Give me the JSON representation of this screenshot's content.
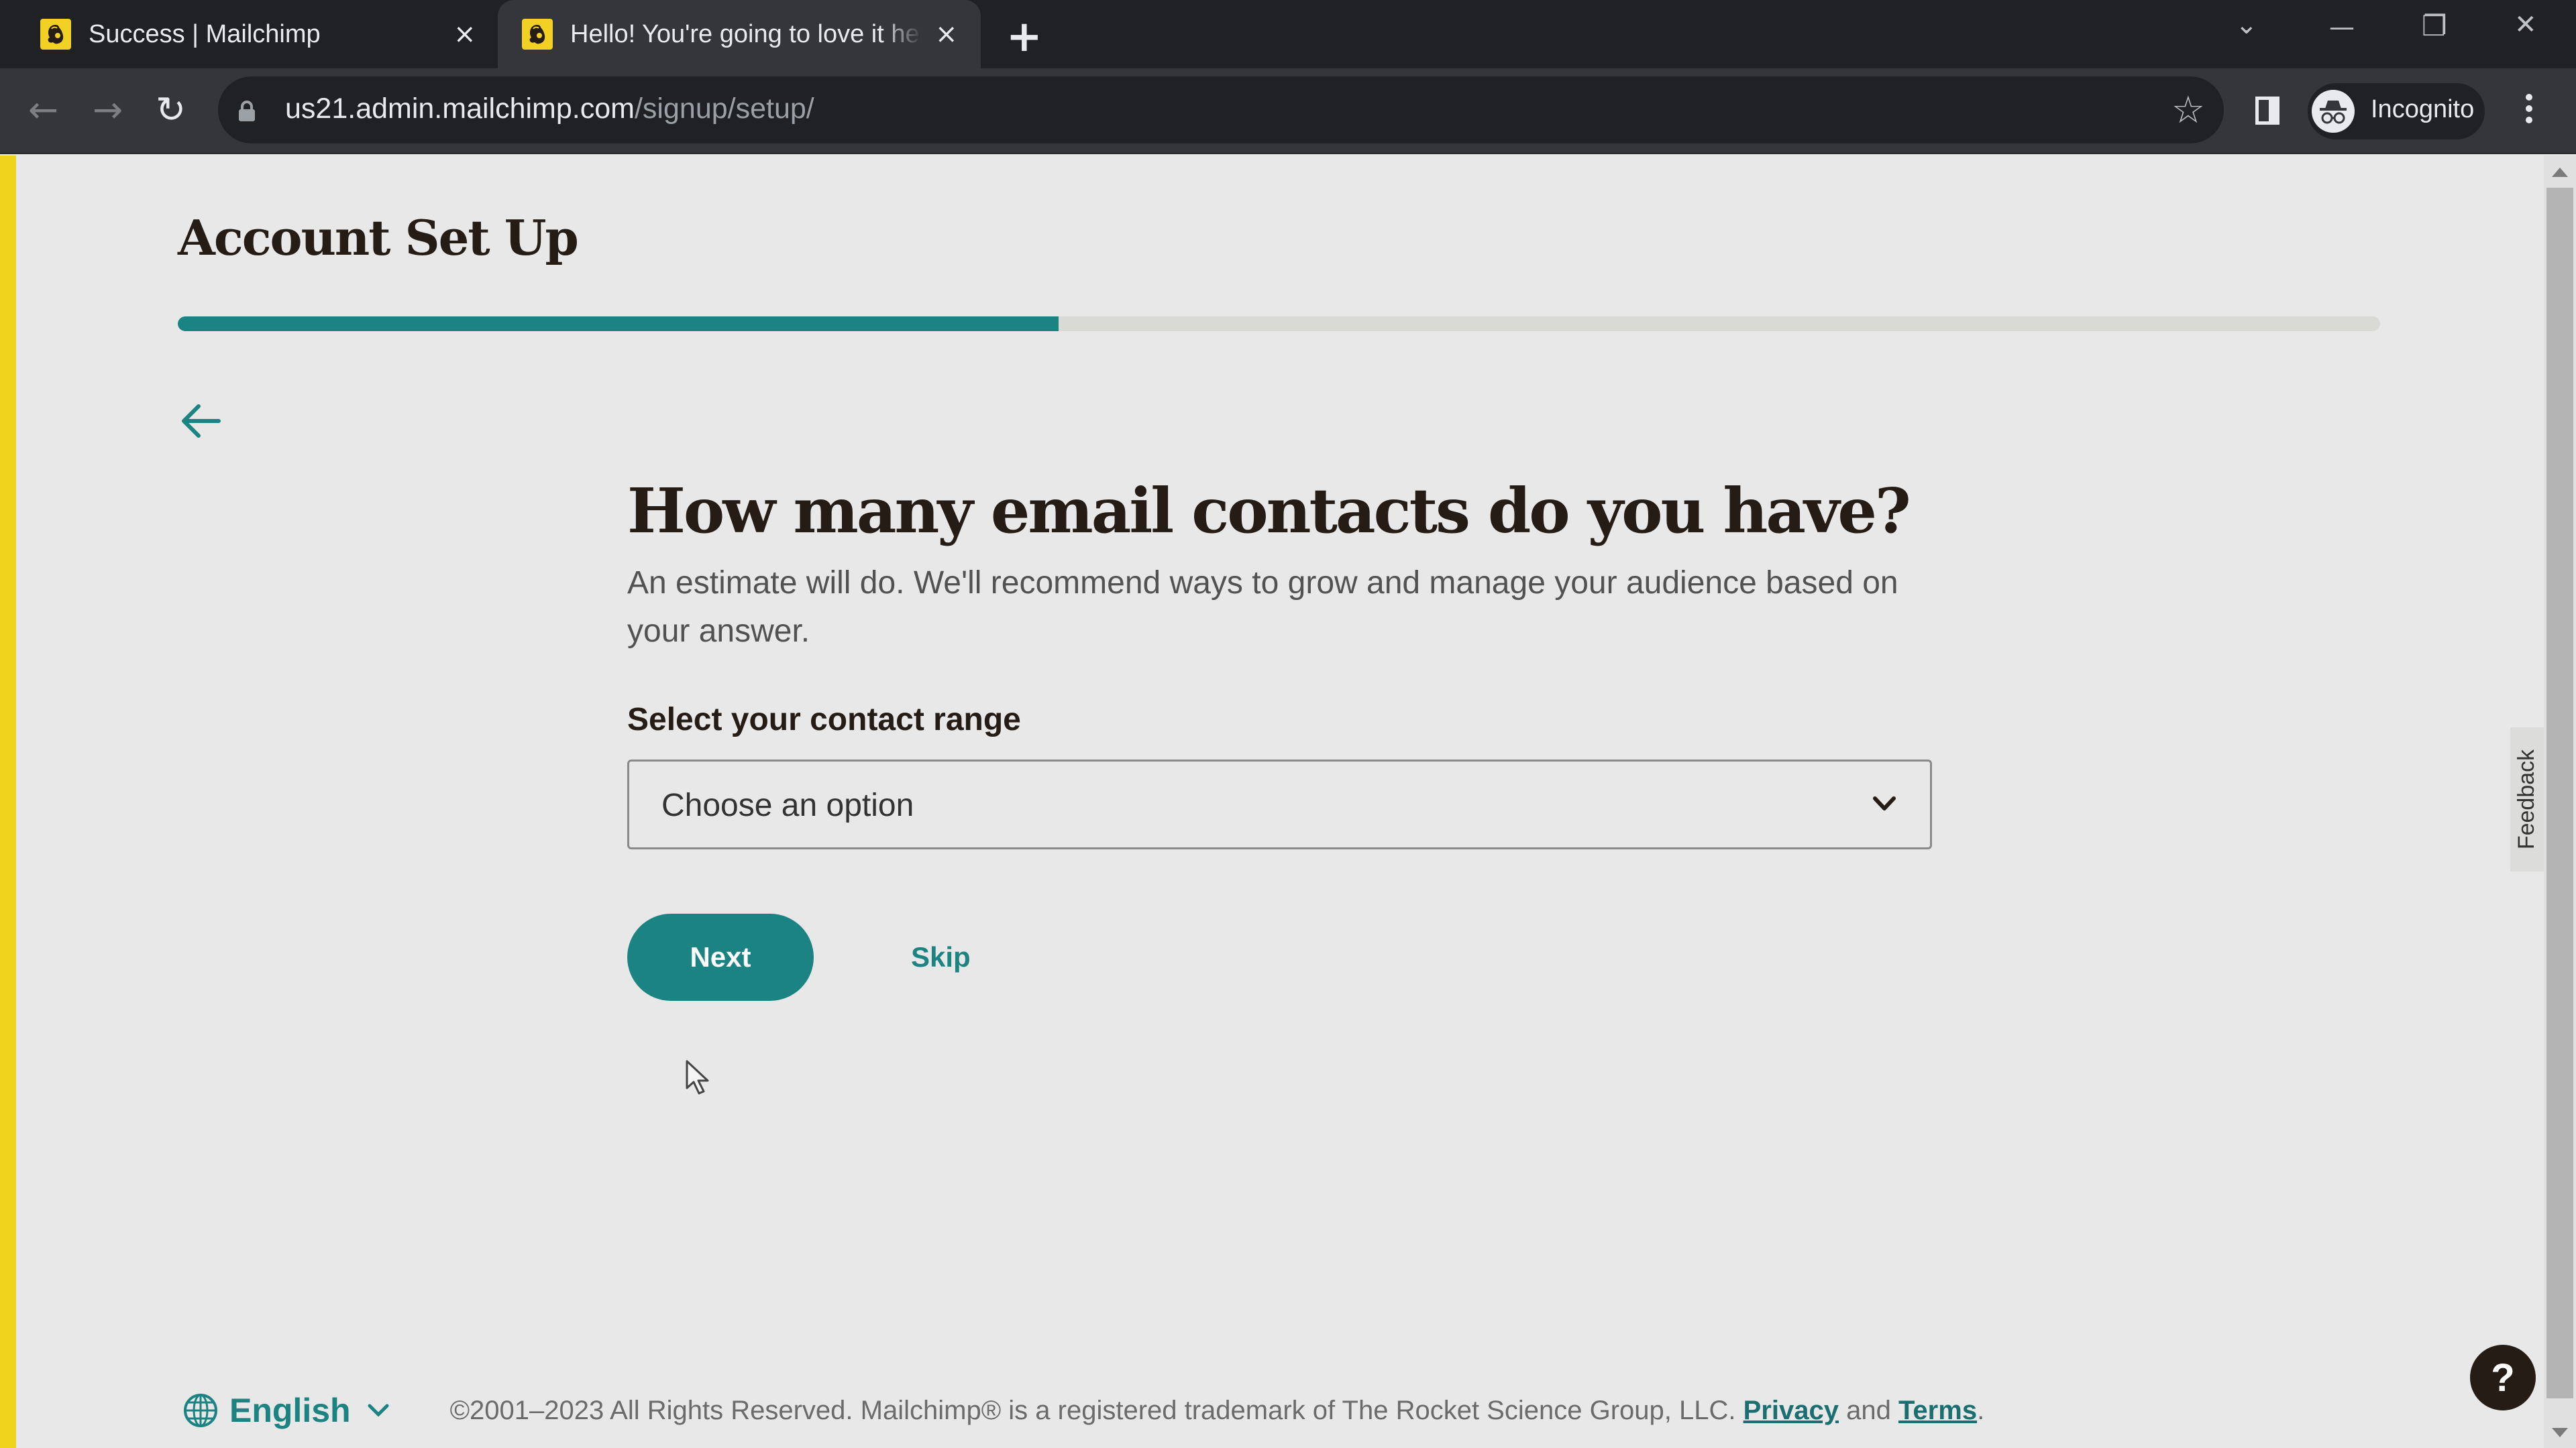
{
  "browser": {
    "tabs": [
      {
        "title": "Success | Mailchimp",
        "active": false
      },
      {
        "title": "Hello! You're going to love it here",
        "active": true
      }
    ],
    "url_host": "us21.admin.mailchimp.com",
    "url_path": "/signup/setup/",
    "profile_label": "Incognito",
    "icons": {
      "new_tab": "+",
      "close_tab": "×",
      "back": "←",
      "forward": "→",
      "reload": "↻",
      "bookmark": "☆",
      "tab_search": "⌄",
      "minimize": "—",
      "restore": "❐",
      "close_window": "✕"
    }
  },
  "page": {
    "title": "Account Set Up",
    "progress_fraction": 0.4,
    "question": "How many email contacts do you have?",
    "description": "An estimate will do. We'll recommend ways to grow and manage your audience based on your answer.",
    "field_label": "Select your contact range",
    "select": {
      "value": "Choose an option"
    },
    "buttons": {
      "next": "Next",
      "skip": "Skip"
    },
    "brand_colors": {
      "accent": "#1b8482",
      "stripe": "#eed41c",
      "text": "#241c15"
    }
  },
  "footer": {
    "language": "English",
    "copyright": "©2001–2023 All Rights Reserved. Mailchimp® is a registered trademark of The Rocket Science Group, LLC.",
    "privacy_link": "Privacy",
    "and_text": "and",
    "terms_link": "Terms",
    "end_punct": "."
  },
  "widgets": {
    "feedback": "Feedback",
    "help": "?"
  }
}
